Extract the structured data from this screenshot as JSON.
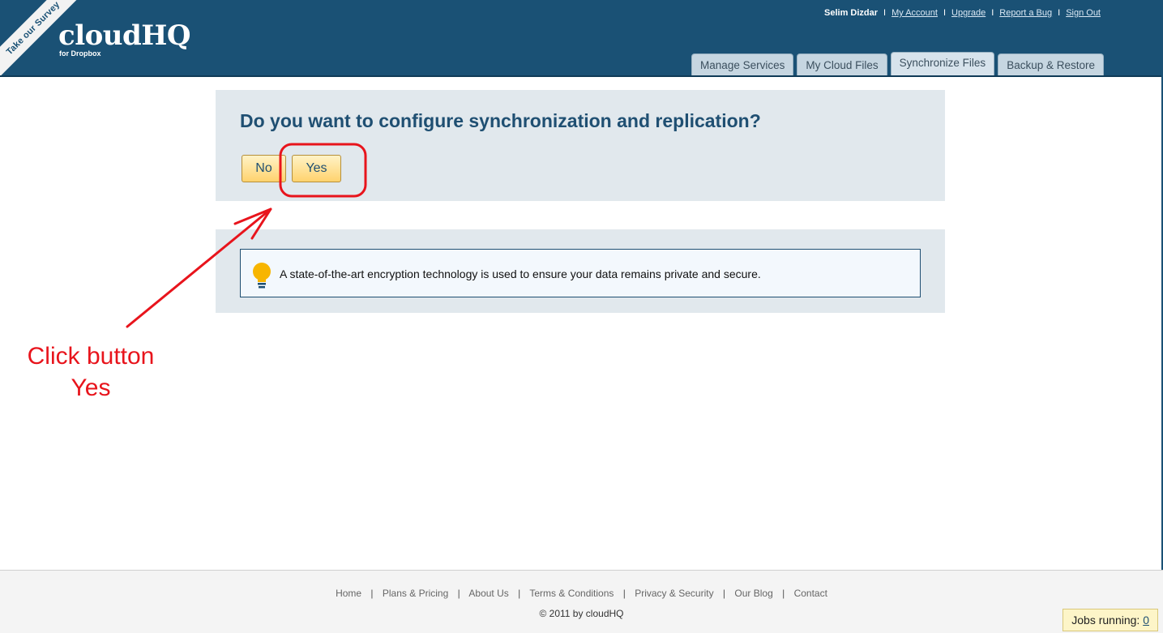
{
  "header": {
    "survey_label": "Take our Survey",
    "logo_text": "cloudHQ",
    "logo_sub": "for Dropbox",
    "user_name": "Selim Dizdar",
    "links": {
      "my_account": "My Account",
      "upgrade": "Upgrade",
      "report_bug": "Report a Bug",
      "sign_out": "Sign Out"
    },
    "separator": "I",
    "tabs": {
      "manage_services": "Manage Services",
      "my_cloud_files": "My Cloud Files",
      "synchronize_files": "Synchronize Files",
      "backup_restore": "Backup & Restore"
    },
    "active_tab": "synchronize_files"
  },
  "main": {
    "question": "Do you want to configure synchronization and replication?",
    "no_label": "No",
    "yes_label": "Yes",
    "info_text": "A state-of-the-art encryption technology is used to ensure your data remains private and secure.",
    "info_icon": "lightbulb-icon"
  },
  "annotation": {
    "line1": "Click button",
    "line2": "Yes",
    "color": "#e8141c"
  },
  "footer": {
    "links": {
      "home": "Home",
      "plans_pricing": "Plans & Pricing",
      "about_us": "About Us",
      "terms": "Terms & Conditions",
      "privacy": "Privacy & Security",
      "blog": "Our Blog",
      "contact": "Contact"
    },
    "separator": "|",
    "copyright": "© 2011 by cloudHQ",
    "jobs_label": "Jobs running:",
    "jobs_count": "0"
  },
  "colors": {
    "header_bg": "#1a5175",
    "panel_bg": "#e1e8ed",
    "heading": "#1f4f72",
    "button_gradient_end": "#ffd36e"
  }
}
